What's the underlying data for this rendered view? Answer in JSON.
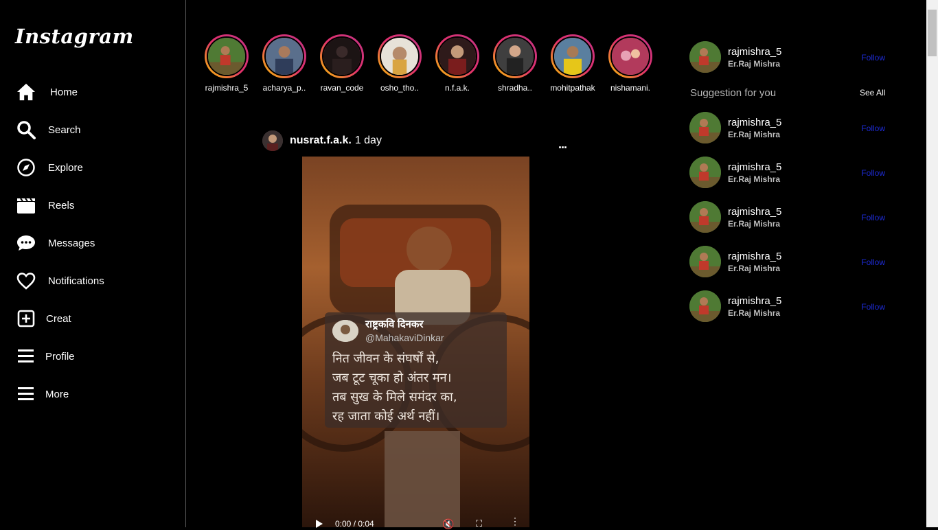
{
  "app": {
    "logo": "Instagram"
  },
  "sidebar": {
    "items": [
      {
        "label": "Home",
        "icon": "home-icon"
      },
      {
        "label": "Search",
        "icon": "search-icon"
      },
      {
        "label": "Explore",
        "icon": "compass-icon"
      },
      {
        "label": "Reels",
        "icon": "clapperboard-icon"
      },
      {
        "label": "Messages",
        "icon": "chat-bubble-icon"
      },
      {
        "label": "Notifications",
        "icon": "heart-icon"
      },
      {
        "label": "Creat",
        "icon": "plus-square-icon"
      },
      {
        "label": "Profile",
        "icon": "hamburger-icon"
      },
      {
        "label": "More",
        "icon": "hamburger-icon"
      }
    ]
  },
  "stories": [
    {
      "name": "rajmishra_5"
    },
    {
      "name": "acharya_p.."
    },
    {
      "name": "ravan_code"
    },
    {
      "name": "osho_tho.."
    },
    {
      "name": "n.f.a.k."
    },
    {
      "name": "shradha.."
    },
    {
      "name": "mohitpathak"
    },
    {
      "name": "nishamani."
    }
  ],
  "post": {
    "username": "nusrat.f.a.k.",
    "time": "1 day",
    "more": "...",
    "video": {
      "quote_name": "राष्ट्रकवि दिनकर",
      "quote_handle": "@MahakaviDinkar",
      "lines": [
        "नित जीवन के संघर्षों से,",
        "जब टूट चूका हो अंतर मन।",
        "तब सुख के मिले समंदर का,",
        "रह जाता कोई अर्थ नहीं।"
      ],
      "time_display": "0:00 / 0:04"
    }
  },
  "right": {
    "profile": {
      "username": "rajmishra_5",
      "full_name": "Er.Raj Mishra",
      "follow": "Follow"
    },
    "suggestion_title": "Suggestion for you",
    "see_all": "See All",
    "suggestions": [
      {
        "username": "rajmishra_5",
        "full_name": "Er.Raj Mishra",
        "follow": "Follow"
      },
      {
        "username": "rajmishra_5",
        "full_name": "Er.Raj Mishra",
        "follow": "Follow"
      },
      {
        "username": "rajmishra_5",
        "full_name": "Er.Raj Mishra",
        "follow": "Follow"
      },
      {
        "username": "rajmishra_5",
        "full_name": "Er.Raj Mishra",
        "follow": "Follow"
      },
      {
        "username": "rajmishra_5",
        "full_name": "Er.Raj Mishra",
        "follow": "Follow"
      }
    ]
  },
  "colors": {
    "follow": "#1d2bd6",
    "ring_start": "#f9c800",
    "ring_end": "#c13584"
  }
}
